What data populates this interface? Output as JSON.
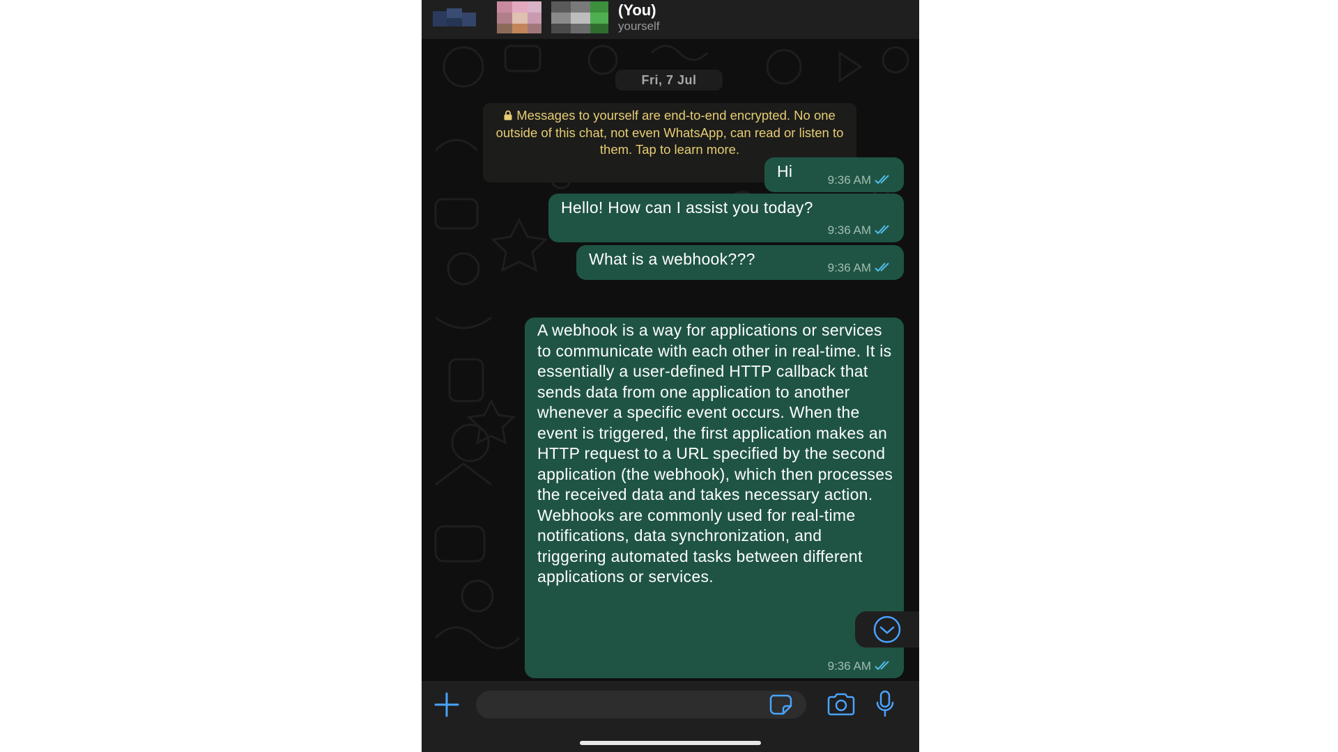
{
  "header": {
    "title": "(You)",
    "subtitle": "yourself"
  },
  "date_chip": "Fri, 7 Jul",
  "encryption_notice": "Messages to yourself are end-to-end encrypted. No one outside of this chat, not even WhatsApp, can read or listen to them. Tap to learn more.",
  "messages": [
    {
      "text": "Hi",
      "time": "9:36 AM",
      "status": "read"
    },
    {
      "text": "Hello! How can I assist you today?",
      "time": "9:36 AM",
      "status": "read"
    },
    {
      "text": "What is a webhook???",
      "time": "9:36 AM",
      "status": "read"
    },
    {
      "text": "A webhook is a way for applications or services to communicate with each other in real-time. It is essentially a user-defined HTTP callback that sends data from one application to another whenever a specific event occurs. When the event is triggered, the first application makes an HTTP request to a URL specified by the second application (the webhook), which then processes the received data and takes necessary action. Webhooks are commonly used for real-time notifications, data synchronization, and triggering automated tasks between different applications or services.",
      "time": "9:36 AM",
      "status": "read"
    }
  ],
  "composer": {
    "value": ""
  },
  "colors": {
    "bubble_outgoing": "#1f5444",
    "read_tick": "#53bdeb",
    "notice_text": "#e7cd74",
    "icon_accent": "#4aa3ff"
  },
  "icons": {
    "attach": "plus-icon",
    "sticker": "sticker-icon",
    "camera": "camera-icon",
    "mic": "microphone-icon",
    "scroll": "chevron-down-icon",
    "lock": "lock-icon",
    "tick": "double-check-icon"
  }
}
